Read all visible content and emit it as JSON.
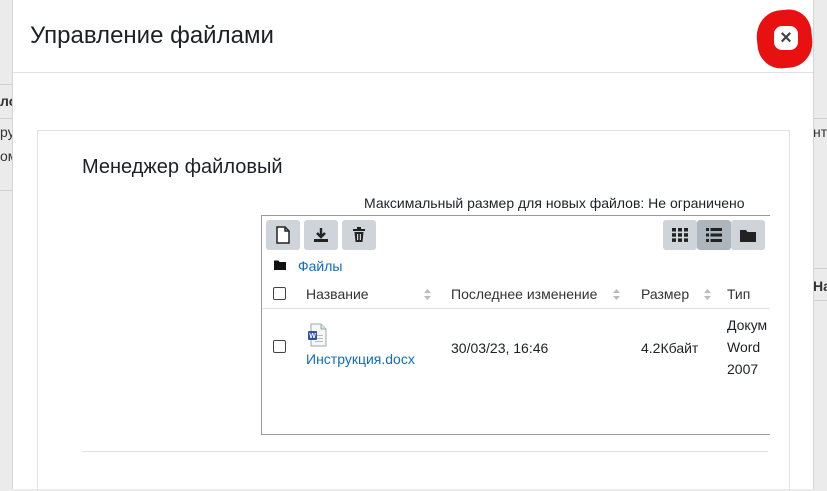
{
  "background": {
    "left_text_1": "ло",
    "left_text_2": "ру",
    "left_text_3": "ом",
    "right_text_1": "нту",
    "right_text_2": "На"
  },
  "modal": {
    "title": "Управление файлами",
    "close_label": "×",
    "close_highlight_color": "#e81010"
  },
  "file_manager": {
    "title": "Менеджер файловый",
    "max_size_text": "Максимальный размер для новых файлов: Не ограничено",
    "toolbar": {
      "left_buttons": [
        "new-file-icon",
        "download-icon",
        "delete-icon"
      ],
      "view_buttons": [
        "grid-view-icon",
        "list-view-icon",
        "folder-view-icon"
      ],
      "active_view": "list-view-icon"
    },
    "breadcrumb": "Файлы",
    "columns": {
      "name": "Название",
      "modified": "Последнее изменение",
      "size": "Размер",
      "type": "Тип"
    },
    "files": [
      {
        "name": "Инструкция.docx",
        "modified": "30/03/23, 16:46",
        "size": "4.2Кбайт",
        "type_line_1": "Докум",
        "type_line_2": "Word",
        "type_line_3": "2007",
        "icon": "word-document-icon"
      }
    ]
  },
  "colors": {
    "link": "#0f6cbf",
    "toolbar_button": "#ced4da",
    "toolbar_button_active": "#adb5bd"
  }
}
